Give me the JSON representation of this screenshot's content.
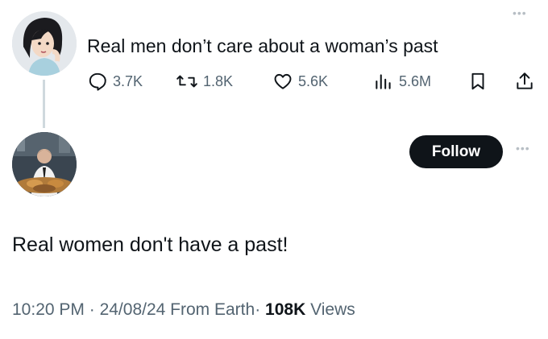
{
  "tweet1": {
    "text": "Real men don’t care about a woman’s past",
    "more_icon": "more-horizontal-icon",
    "actions": {
      "replies": "3.7K",
      "retweets": "1.8K",
      "likes": "5.6K",
      "views": "5.6M"
    }
  },
  "tweet2": {
    "follow_label": "Follow",
    "more_icon": "more-horizontal-icon",
    "text": "Real women don't have a past!",
    "meta": {
      "time": "10:20 PM",
      "sep1": "·",
      "date": "24/08/24",
      "source": "From Earth",
      "sep2": "·",
      "views_count": "108K",
      "views_label": "Views"
    }
  },
  "colors": {
    "text": "#0f1419",
    "secondary": "#536471",
    "thread_line": "#cfd9de",
    "follow_bg": "#0f1419"
  }
}
